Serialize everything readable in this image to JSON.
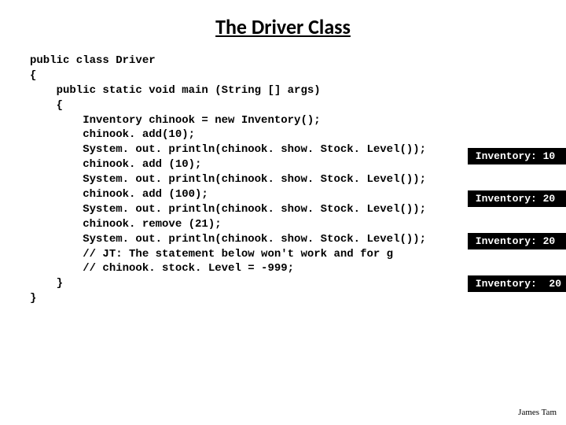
{
  "title": "The Driver Class",
  "code": {
    "l0": "public class Driver",
    "l1": "{",
    "l2": "    public static void main (String [] args)",
    "l3": "    {",
    "l4": "        Inventory chinook = new Inventory();",
    "l5": "        chinook. add(10);",
    "l6": "        System. out. println(chinook. show. Stock. Level());",
    "l7": "        chinook. add (10);",
    "l8": "        System. out. println(chinook. show. Stock. Level());",
    "l9": "        chinook. add (100);",
    "l10": "        System. out. println(chinook. show. Stock. Level());",
    "l11": "        chinook. remove (21);",
    "l12": "        System. out. println(chinook. show. Stock. Level());",
    "l13": "        // JT: The statement below won't work and for g",
    "l14": "        // chinook. stock. Level = -999;",
    "l15": "    }",
    "l16": "}"
  },
  "outputs": {
    "o0": "Inventory: 10",
    "o1": "Inventory: 20",
    "o2": "Inventory: 20",
    "o3": "Inventory:  20"
  },
  "footer": "James Tam"
}
